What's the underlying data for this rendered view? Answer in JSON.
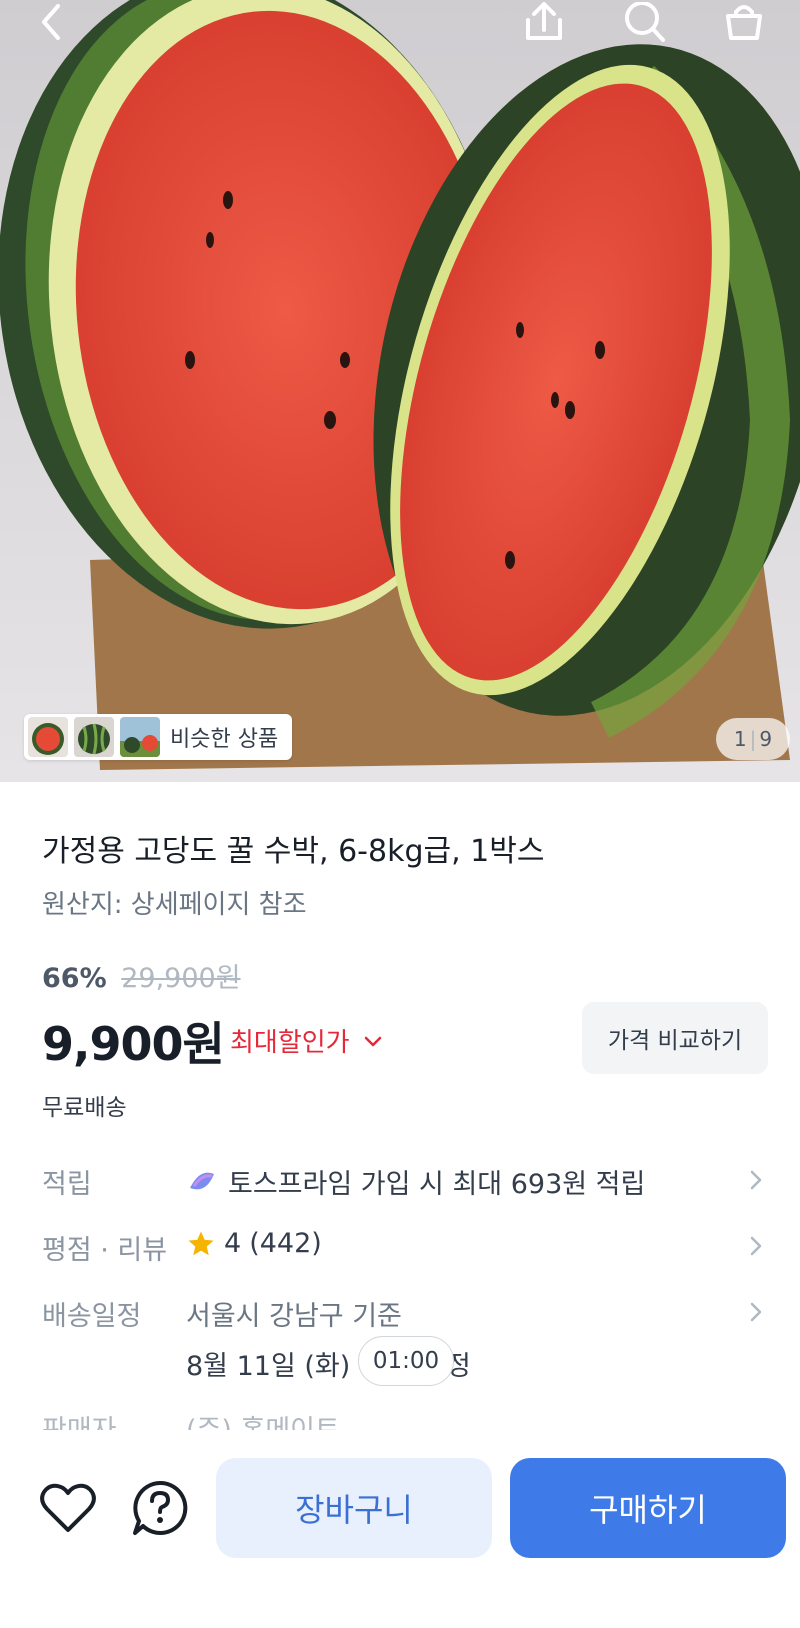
{
  "header": {
    "icons": [
      "back-icon",
      "share-icon",
      "search-icon",
      "cart-bag-icon"
    ]
  },
  "gallery": {
    "similar_label": "비슷한 상품",
    "current_page": "1",
    "total_pages": "9"
  },
  "product": {
    "title": "가정용 고당도 꿀 수박, 6-8kg급, 1박스",
    "origin": "원산지: 상세페이지 참조",
    "discount_percent": "66%",
    "original_price": "29,900원",
    "price": "9,900원",
    "max_discount_label": "최대할인가",
    "compare_button": "가격 비교하기",
    "shipping": "무료배송"
  },
  "info_rows": {
    "points": {
      "label": "적립",
      "value": "토스프라임 가입 시 최대 693원 적립"
    },
    "rating": {
      "label": "평점 · 리뷰",
      "score": "4",
      "count": "(442)"
    },
    "delivery": {
      "label": "배송일정",
      "line1": "서울시 강남구 기준",
      "line2_date": "8월 11일 (화)",
      "line2_suffix": "정",
      "timer": "01:00"
    },
    "seller": {
      "label": "판매자",
      "value": "(주) 홈메이트"
    }
  },
  "bottom_bar": {
    "cart_button": "장바구니",
    "buy_button": "구매하기"
  },
  "colors": {
    "accent": "#3e7be9",
    "accent_light": "#e8f0fd",
    "discount_red": "#e42939",
    "star": "#f5b400"
  }
}
